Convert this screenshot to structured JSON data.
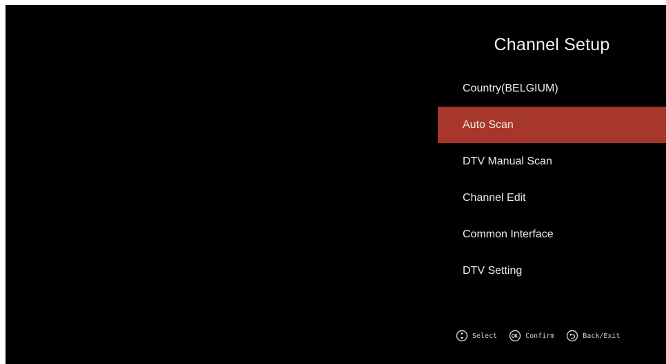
{
  "menu": {
    "title": "Channel Setup",
    "selected_index": 1,
    "items": [
      {
        "label": "Country(BELGIUM)"
      },
      {
        "label": "Auto Scan"
      },
      {
        "label": "DTV Manual Scan"
      },
      {
        "label": "Channel Edit"
      },
      {
        "label": "Common Interface"
      },
      {
        "label": "DTV Setting"
      }
    ]
  },
  "help": {
    "select_label": "Select",
    "select_icon": "updown-circle-icon",
    "confirm_label": "Confirm",
    "confirm_icon": "ok-circle-icon",
    "back_label": "Back/Exit",
    "back_icon": "back-arrow-circle-icon"
  },
  "colors": {
    "background": "#000000",
    "highlight": "#a7372a",
    "text": "#ececec"
  }
}
